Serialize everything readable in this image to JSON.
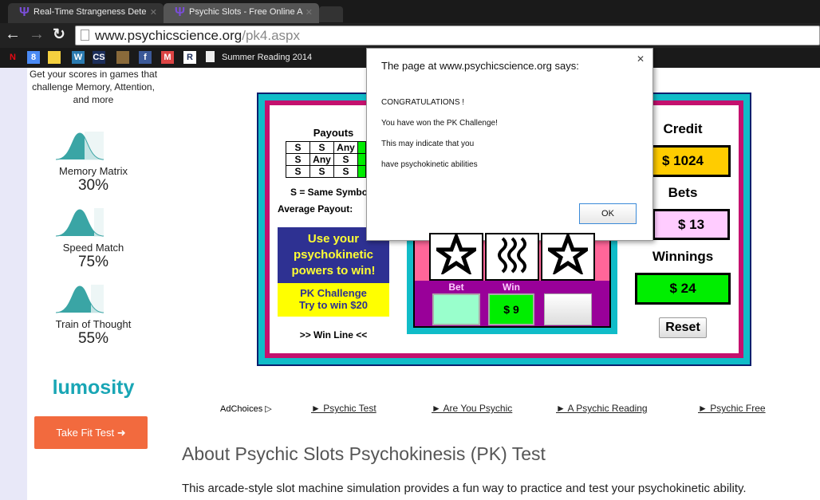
{
  "browser": {
    "tabs": [
      {
        "title": "Real-Time Strangeness Dete"
      },
      {
        "title": "Psychic Slots - Free Online A"
      }
    ],
    "url_host": "www.psychicscience.org",
    "url_path": "/pk4.aspx",
    "bookmarks": [
      {
        "icon": "netflix-icon",
        "label": "N",
        "color": "#e50914"
      },
      {
        "icon": "google-icon",
        "label": "8",
        "color": "#4a8af4"
      },
      {
        "icon": "bulb-icon",
        "label": "",
        "color": "#f4d03f"
      },
      {
        "icon": "wordpress-icon",
        "label": "W",
        "color": "#2a7ab0"
      },
      {
        "icon": "cs-icon",
        "label": "CS",
        "color": "#1c2e5a"
      },
      {
        "icon": "chest-icon",
        "label": "",
        "color": "#8a6a3a"
      },
      {
        "icon": "facebook-icon",
        "label": "f",
        "color": "#3b5998"
      },
      {
        "icon": "gmail-icon",
        "label": "M",
        "color": "#d44"
      },
      {
        "icon": "r-icon",
        "label": "R",
        "color": "#fff"
      }
    ],
    "bookmark_folder": "Summer Reading 2014"
  },
  "sidebar": {
    "intro": "Get your scores in games that challenge Memory, Attention, and more",
    "games": [
      {
        "name": "Memory Matrix",
        "score": "30%"
      },
      {
        "name": "Speed Match",
        "score": "75%"
      },
      {
        "name": "Train of Thought",
        "score": "55%"
      }
    ],
    "brand": "lumosity",
    "cta": "Take Fit Test ➜"
  },
  "slots": {
    "payouts_title": "Payouts",
    "payout_rows": [
      [
        "S",
        "S",
        "Any"
      ],
      [
        "S",
        "Any",
        "S"
      ],
      [
        "S",
        "S",
        "S"
      ]
    ],
    "legend": "S = Same Symbol",
    "avg_payout": "Average Payout: ",
    "promo": "Use your psychokinetic powers to win!",
    "challenge": "PK Challenge",
    "challenge_sub": "Try to win $20",
    "win_line": ">> Win Line <<",
    "reels": [
      "star",
      "waves",
      "star"
    ],
    "bet_label": "Bet",
    "win_label": "Win",
    "bet_value": "",
    "win_value": "$ 9",
    "credit_label": "Credit",
    "credit": "$ 1024",
    "bets_label": "Bets",
    "bets": "$ 13",
    "winnings_label": "Winnings",
    "winnings": "$ 24",
    "reset": "Reset"
  },
  "dialog": {
    "title": "The page at www.psychicscience.org says:",
    "lines": [
      "CONGRATULATIONS !",
      "You have won the PK Challenge!",
      "This may indicate that you",
      "have psychokinetic abilities"
    ],
    "ok": "OK"
  },
  "ads": {
    "adchoices": "AdChoices",
    "links": [
      "► Psychic Test",
      "► Are You Psychic",
      "► A Psychic Reading",
      "► Psychic Free"
    ]
  },
  "article": {
    "heading": "About Psychic Slots Psychokinesis (PK) Test",
    "body": "This arcade-style slot machine simulation provides a fun way to practice and test your psychokinetic ability."
  }
}
